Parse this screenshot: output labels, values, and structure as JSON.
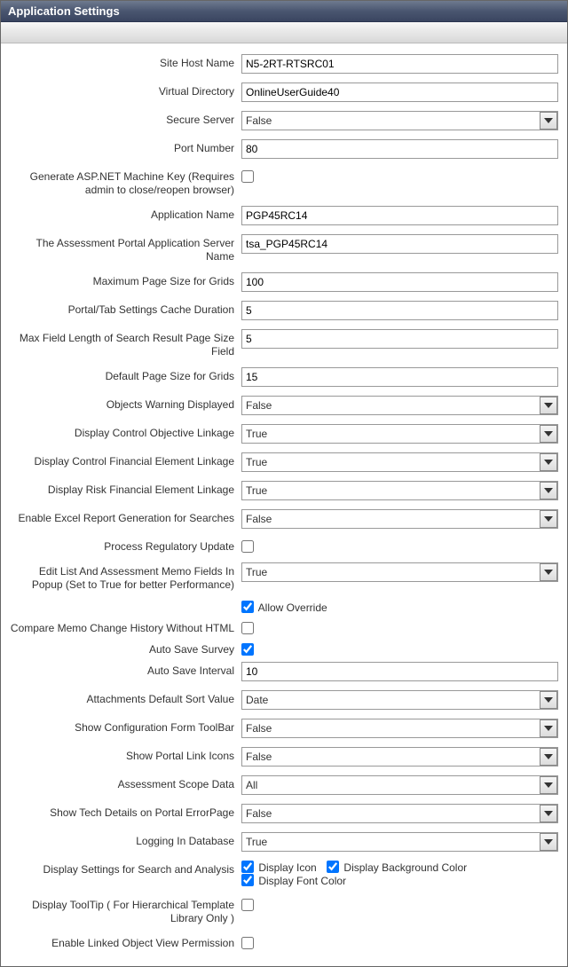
{
  "window": {
    "title": "Application Settings"
  },
  "fields": {
    "siteHostName": {
      "label": "Site Host Name",
      "value": "N5-2RT-RTSRC01"
    },
    "virtualDirectory": {
      "label": "Virtual Directory",
      "value": "OnlineUserGuide40"
    },
    "secureServer": {
      "label": "Secure Server",
      "value": "False"
    },
    "portNumber": {
      "label": "Port Number",
      "value": "80"
    },
    "generateMachineKey": {
      "label": "Generate ASP.NET Machine Key (Requires admin to close/reopen browser)",
      "checked": false
    },
    "applicationName": {
      "label": "Application Name",
      "value": "PGP45RC14"
    },
    "assessmentServerName": {
      "label": "The Assessment Portal Application Server Name",
      "value": "tsa_PGP45RC14"
    },
    "maxPageSizeGrids": {
      "label": "Maximum Page Size for Grids",
      "value": "100"
    },
    "portalTabCache": {
      "label": "Portal/Tab Settings Cache Duration",
      "value": "5"
    },
    "maxFieldLenSearch": {
      "label": "Max Field Length of Search Result Page Size Field",
      "value": "5"
    },
    "defaultPageSizeGrids": {
      "label": "Default Page Size for Grids",
      "value": "15"
    },
    "objectsWarningDisplayed": {
      "label": "Objects Warning Displayed",
      "value": "False"
    },
    "displayCtrlObjLink": {
      "label": "Display Control Objective Linkage",
      "value": "True"
    },
    "displayCtrlFinElemLink": {
      "label": "Display Control Financial Element Linkage",
      "value": "True"
    },
    "displayRiskFinElemLink": {
      "label": "Display Risk Financial Element Linkage",
      "value": "True"
    },
    "enableExcelReport": {
      "label": "Enable Excel Report Generation for Searches",
      "value": "False"
    },
    "processRegUpdate": {
      "label": "Process Regulatory Update",
      "checked": false
    },
    "editListMemoPopup": {
      "label": "Edit List And Assessment Memo Fields In Popup (Set to True for better Performance)",
      "value": "True"
    },
    "allowOverride": {
      "label": "Allow Override",
      "checked": true
    },
    "compareMemoNoHtml": {
      "label": "Compare Memo Change History Without HTML",
      "checked": false
    },
    "autoSaveSurvey": {
      "label": "Auto Save Survey",
      "checked": true
    },
    "autoSaveInterval": {
      "label": "Auto Save Interval",
      "value": "10"
    },
    "attachmentsSort": {
      "label": "Attachments Default Sort Value",
      "value": "Date"
    },
    "showConfigToolbar": {
      "label": "Show Configuration Form ToolBar",
      "value": "False"
    },
    "showPortalLinkIcons": {
      "label": "Show Portal Link Icons",
      "value": "False"
    },
    "assessmentScopeData": {
      "label": "Assessment Scope Data",
      "value": "All"
    },
    "showTechErrorPage": {
      "label": "Show Tech Details on Portal ErrorPage",
      "value": "False"
    },
    "loggingInDb": {
      "label": "Logging In Database",
      "value": "True"
    },
    "displaySettingsSearch": {
      "label": "Display Settings for Search and Analysis",
      "icon": {
        "label": "Display Icon",
        "checked": true
      },
      "bg": {
        "label": "Display Background Color",
        "checked": true
      },
      "font": {
        "label": "Display Font Color",
        "checked": true
      }
    },
    "displayTooltipHierTpl": {
      "label": "Display ToolTip ( For Hierarchical Template Library Only )",
      "checked": false
    },
    "enableLinkedObjView": {
      "label": "Enable Linked Object View Permission",
      "checked": false
    }
  }
}
